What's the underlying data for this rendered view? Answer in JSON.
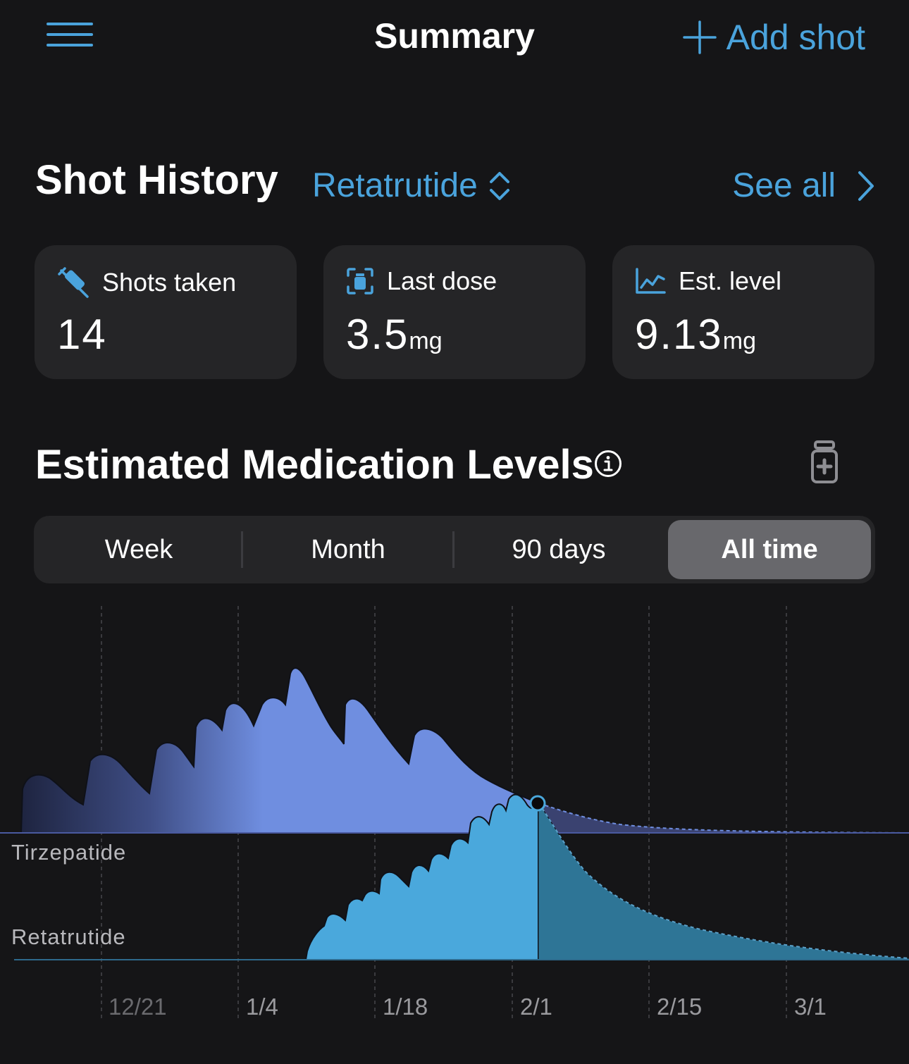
{
  "nav": {
    "title": "Summary",
    "add_label": "Add shot",
    "menu_icon": "hamburger-menu-icon",
    "add_icon": "plus-icon"
  },
  "history": {
    "title": "Shot History",
    "medication": "Retatrutide",
    "see_all": "See all"
  },
  "cards": [
    {
      "label": "Shots taken",
      "value": "14",
      "unit": "",
      "icon": "syringe-icon"
    },
    {
      "label": "Last dose",
      "value": "3.5",
      "unit": "mg",
      "icon": "vial-dose-icon"
    },
    {
      "label": "Est. level",
      "value": "9.13",
      "unit": "mg",
      "icon": "line-chart-icon"
    }
  ],
  "levels": {
    "title": "Estimated Medication Levels",
    "tabs": [
      "Week",
      "Month",
      "90 days",
      "All time"
    ],
    "selected_tab": "All time"
  },
  "colors": {
    "background": "#151517",
    "accent": "#4aa3dc",
    "tirzepatide": "#6f8ee0",
    "retatrutide": "#4aa8dc",
    "card": "#252527"
  },
  "chart_data": {
    "type": "area",
    "x_tick_labels": [
      "12/21",
      "1/4",
      "1/18",
      "2/1",
      "2/15",
      "3/1"
    ],
    "current_date": "2/1",
    "series": [
      {
        "name": "Tirzepatide"
      },
      {
        "name": "Retatrutide"
      }
    ]
  }
}
